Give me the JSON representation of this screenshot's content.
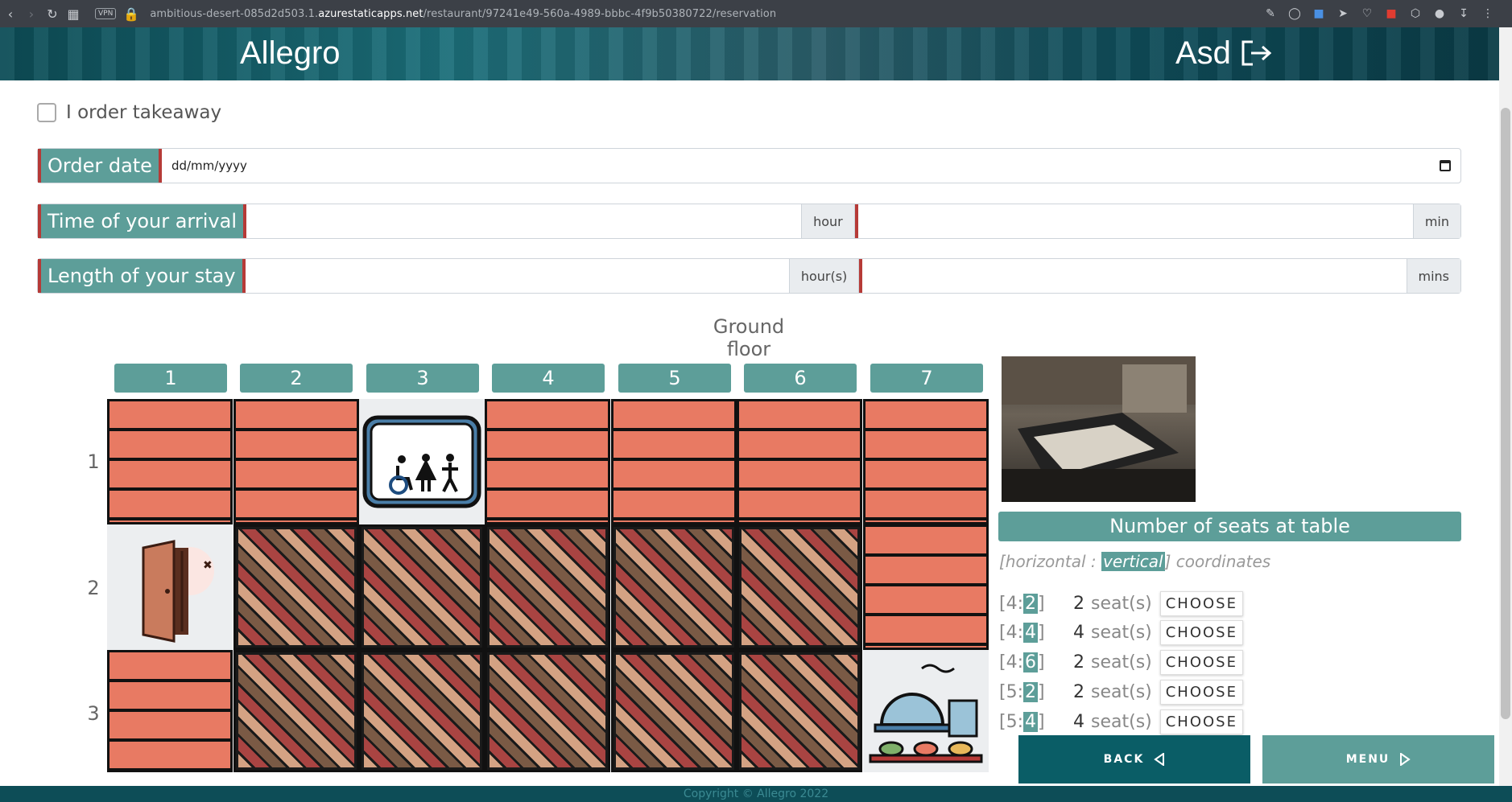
{
  "browser": {
    "vpn_label": "VPN",
    "url_prefix": "ambitious-desert-085d2d503.1.",
    "url_domain": "azurestaticapps.net",
    "url_path": "/restaurant/97241e49-560a-4989-bbbc-4f9b50380722/reservation"
  },
  "header": {
    "brand": "Allegro",
    "user": "Asd"
  },
  "form": {
    "takeaway_label": "I order takeaway",
    "order_date_label": "Order date",
    "order_date_placeholder": "dd/mm/yyyy",
    "arrival_label": "Time of your arrival",
    "arrival_hour_addon": "hour",
    "arrival_min_addon": "min",
    "stay_label": "Length of your stay",
    "stay_hours_addon": "hour(s)",
    "stay_mins_addon": "mins"
  },
  "floor": {
    "title": "Ground floor",
    "columns": [
      "1",
      "2",
      "3",
      "4",
      "5",
      "6",
      "7"
    ],
    "rows": [
      "1",
      "2",
      "3"
    ],
    "toilets_sign": "TOILETS"
  },
  "panel": {
    "seats_heading": "Number of seats at table",
    "coords_prefix": "[horizontal : ",
    "coords_highlight": "vertical",
    "coords_suffix": "] coordinates",
    "seat_unit": "seat(s)",
    "choose_label": "CHOOSE",
    "tables": [
      {
        "h": "4",
        "v": "2",
        "seats": "2"
      },
      {
        "h": "4",
        "v": "4",
        "seats": "4"
      },
      {
        "h": "4",
        "v": "6",
        "seats": "2"
      },
      {
        "h": "5",
        "v": "2",
        "seats": "2"
      },
      {
        "h": "5",
        "v": "4",
        "seats": "4"
      }
    ]
  },
  "nav": {
    "back_label": "BACK",
    "menu_label": "MENU"
  },
  "footer": {
    "copyright": "Copyright © Allegro 2022"
  },
  "colors": {
    "teal": "#5d9e99",
    "dark_teal": "#0a5d66",
    "accent_red": "#b63a37",
    "brick": "#e87a63"
  }
}
